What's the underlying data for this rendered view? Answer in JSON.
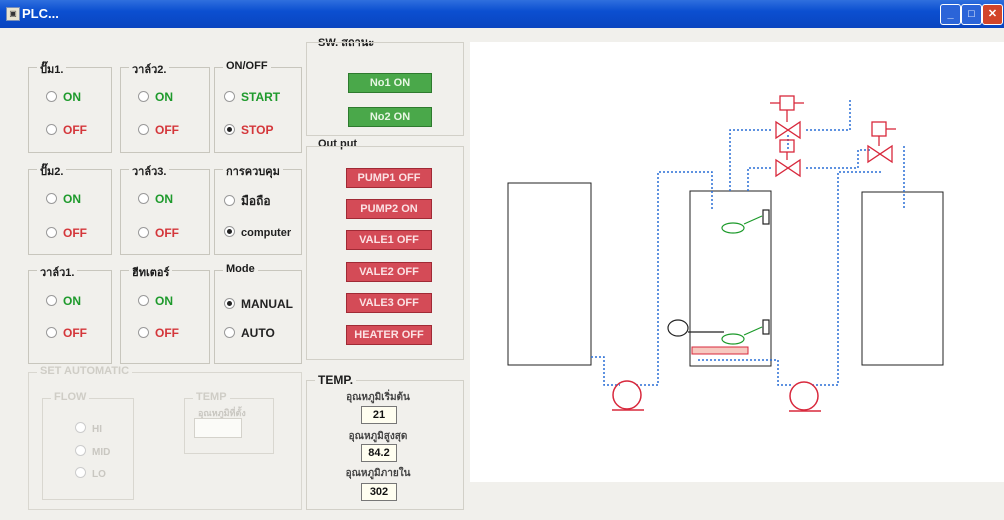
{
  "window": {
    "title": "PLC..."
  },
  "groups": {
    "pump1": {
      "caption": "ปั๊ม1.",
      "on": "ON",
      "off": "OFF"
    },
    "valve2": {
      "caption": "วาล์ว2.",
      "on": "ON",
      "off": "OFF"
    },
    "onoff": {
      "caption": "ON/OFF",
      "start": "START",
      "stop": "STOP"
    },
    "pump2": {
      "caption": "ปั๊ม2.",
      "on": "ON",
      "off": "OFF"
    },
    "valve3": {
      "caption": "วาล์ว3.",
      "on": "ON",
      "off": "OFF"
    },
    "control": {
      "caption": "การควบคุม",
      "hand": "มือถือ",
      "computer": "computer"
    },
    "valve1": {
      "caption": "วาล์ว1.",
      "on": "ON",
      "off": "OFF"
    },
    "heater": {
      "caption": "ฮีทเตอร์",
      "on": "ON",
      "off": "OFF"
    },
    "mode": {
      "caption": "Mode",
      "manual": "MANUAL",
      "auto": "AUTO"
    },
    "auto_box": {
      "caption": "SET AUTOMATIC",
      "flow_caption": "FLOW",
      "flow_options": [
        "HI",
        "MID",
        "LO"
      ],
      "temp_caption": "TEMP",
      "temp_label": "อุณหภูมิที่ตั้ง"
    }
  },
  "sw_status": {
    "caption": "SW. สถานะ",
    "buttons": [
      "No1 ON",
      "No2 ON"
    ]
  },
  "outputs": {
    "caption": "Out put",
    "buttons": [
      "PUMP1 OFF",
      "PUMP2 ON",
      "VALE1 OFF",
      "VALE2 OFF",
      "VALE3 OFF",
      "HEATER OFF"
    ]
  },
  "temp": {
    "caption": "TEMP.",
    "readings": [
      {
        "label": "อุณหภูมิเริ่มต้น",
        "value": "21"
      },
      {
        "label": "อุณหภูมิสูงสุด",
        "value": "84.2"
      },
      {
        "label": "อุณหภูมิภายใน",
        "value": "302"
      }
    ]
  },
  "colors": {
    "on_green": "#1e9a2c",
    "off_red": "#d4363a",
    "status_button": "#4aa84a",
    "output_button": "#d44b57",
    "pipe_blue": "#2a6fd6",
    "equipment_red": "#d8283c"
  }
}
